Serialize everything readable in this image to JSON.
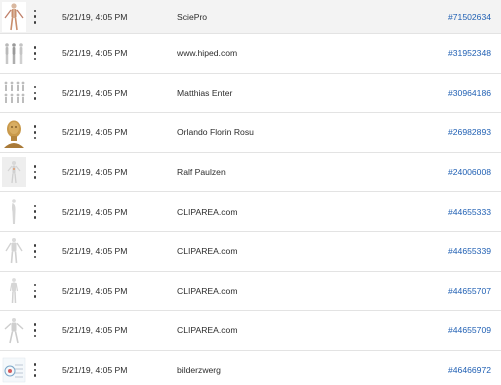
{
  "rows": [
    {
      "thumb": "skeleton-thumbnail-icon",
      "date": "5/21/19, 4:05 PM",
      "author": "SciePro",
      "id": "#71502634"
    },
    {
      "thumb": "body-figures-thumbnail-icon",
      "date": "5/21/19, 4:05 PM",
      "author": "www.hiped.com",
      "id": "#31952348"
    },
    {
      "thumb": "anatomy-grid-thumbnail-icon",
      "date": "5/21/19, 4:05 PM",
      "author": "Matthias Enter",
      "id": "#30964186"
    },
    {
      "thumb": "golden-head-thumbnail-icon",
      "date": "5/21/19, 4:05 PM",
      "author": "Orlando Florin Rosu",
      "id": "#26982893"
    },
    {
      "thumb": "standing-figure-thumbnail-icon",
      "date": "5/21/19, 4:05 PM",
      "author": "Ralf Paulzen",
      "id": "#24006008"
    },
    {
      "thumb": "mannequin-side-thumbnail-icon",
      "date": "5/21/19, 4:05 PM",
      "author": "CLIPAREA.com",
      "id": "#44655333"
    },
    {
      "thumb": "mannequin-front-thumbnail-icon",
      "date": "5/21/19, 4:05 PM",
      "author": "CLIPAREA.com",
      "id": "#44655339"
    },
    {
      "thumb": "mannequin-back-thumbnail-icon",
      "date": "5/21/19, 4:05 PM",
      "author": "CLIPAREA.com",
      "id": "#44655707"
    },
    {
      "thumb": "mannequin-pose-thumbnail-icon",
      "date": "5/21/19, 4:05 PM",
      "author": "CLIPAREA.com",
      "id": "#44655709"
    },
    {
      "thumb": "anatomy-chart-thumbnail-icon",
      "date": "5/21/19, 4:05 PM",
      "author": "bilderzwerg",
      "id": "#46466972"
    }
  ],
  "colors": {
    "link": "#1f5fb3",
    "text": "#2c2c2c",
    "row_highlight": "#f3f3f3",
    "divider": "#e3e3e3"
  }
}
